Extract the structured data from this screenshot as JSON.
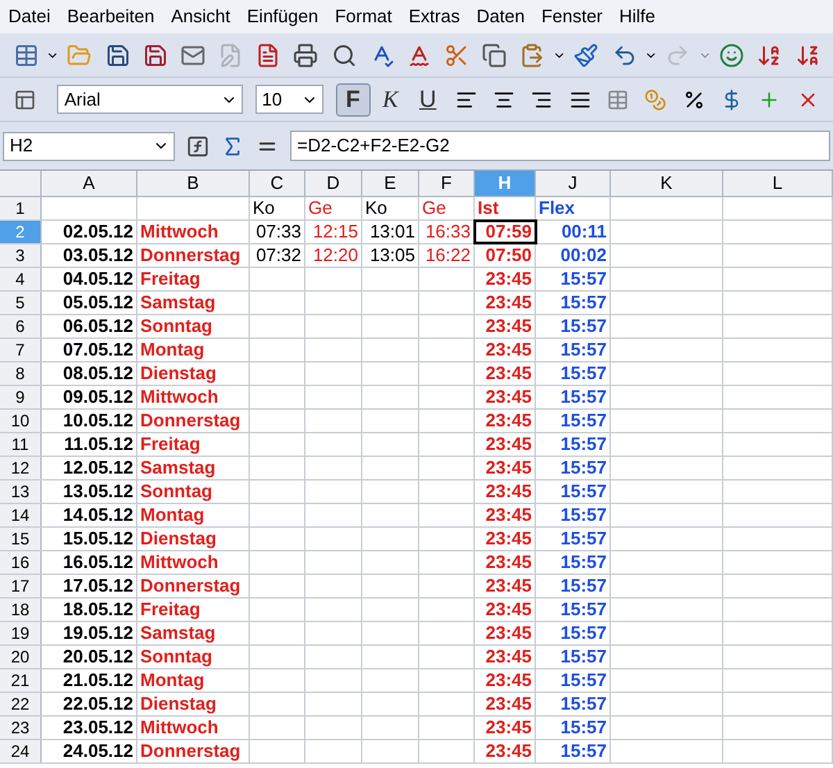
{
  "menu": [
    "Datei",
    "Bearbeiten",
    "Ansicht",
    "Einfügen",
    "Format",
    "Extras",
    "Daten",
    "Fenster",
    "Hilfe"
  ],
  "font_name": "Arial",
  "font_size": "10",
  "format_buttons": [
    {
      "label": "F",
      "selected": true
    },
    {
      "label": "K",
      "selected": false
    },
    {
      "label": "U",
      "selected": false
    }
  ],
  "name_box": "H2",
  "formula": "=D2-C2+F2-E2-G2",
  "columns": [
    {
      "label": "A",
      "selected": false
    },
    {
      "label": "B",
      "selected": false
    },
    {
      "label": "C",
      "selected": false
    },
    {
      "label": "D",
      "selected": false
    },
    {
      "label": "E",
      "selected": false
    },
    {
      "label": "F",
      "selected": false
    },
    {
      "label": "H",
      "selected": true
    },
    {
      "label": "J",
      "selected": false
    },
    {
      "label": "K",
      "selected": false
    },
    {
      "label": "L",
      "selected": false
    }
  ],
  "rows": [
    {
      "num": "1",
      "selected": false,
      "cells": {
        "C": "Ko",
        "D": "Ge",
        "E": "Ko",
        "F": "Ge",
        "H": "Ist",
        "J": "Flex"
      }
    },
    {
      "num": "2",
      "selected": true,
      "cells": {
        "A": "02.05.12",
        "B": "Mittwoch",
        "C": "07:33",
        "D": "12:15",
        "E": "13:01",
        "F": "16:33",
        "H": "07:59",
        "J": "00:11"
      }
    },
    {
      "num": "3",
      "selected": false,
      "cells": {
        "A": "03.05.12",
        "B": "Donnerstag",
        "C": "07:32",
        "D": "12:20",
        "E": "13:05",
        "F": "16:22",
        "H": "07:50",
        "J": "00:02"
      }
    },
    {
      "num": "4",
      "selected": false,
      "cells": {
        "A": "04.05.12",
        "B": "Freitag",
        "H": "23:45",
        "J": "15:57"
      }
    },
    {
      "num": "5",
      "selected": false,
      "cells": {
        "A": "05.05.12",
        "B": "Samstag",
        "H": "23:45",
        "J": "15:57"
      }
    },
    {
      "num": "6",
      "selected": false,
      "cells": {
        "A": "06.05.12",
        "B": "Sonntag",
        "H": "23:45",
        "J": "15:57"
      }
    },
    {
      "num": "7",
      "selected": false,
      "cells": {
        "A": "07.05.12",
        "B": "Montag",
        "H": "23:45",
        "J": "15:57"
      }
    },
    {
      "num": "8",
      "selected": false,
      "cells": {
        "A": "08.05.12",
        "B": "Dienstag",
        "H": "23:45",
        "J": "15:57"
      }
    },
    {
      "num": "9",
      "selected": false,
      "cells": {
        "A": "09.05.12",
        "B": "Mittwoch",
        "H": "23:45",
        "J": "15:57"
      }
    },
    {
      "num": "10",
      "selected": false,
      "cells": {
        "A": "10.05.12",
        "B": "Donnerstag",
        "H": "23:45",
        "J": "15:57"
      }
    },
    {
      "num": "11",
      "selected": false,
      "cells": {
        "A": "11.05.12",
        "B": "Freitag",
        "H": "23:45",
        "J": "15:57"
      }
    },
    {
      "num": "12",
      "selected": false,
      "cells": {
        "A": "12.05.12",
        "B": "Samstag",
        "H": "23:45",
        "J": "15:57"
      }
    },
    {
      "num": "13",
      "selected": false,
      "cells": {
        "A": "13.05.12",
        "B": "Sonntag",
        "H": "23:45",
        "J": "15:57"
      }
    },
    {
      "num": "14",
      "selected": false,
      "cells": {
        "A": "14.05.12",
        "B": "Montag",
        "H": "23:45",
        "J": "15:57"
      }
    },
    {
      "num": "15",
      "selected": false,
      "cells": {
        "A": "15.05.12",
        "B": "Dienstag",
        "H": "23:45",
        "J": "15:57"
      }
    },
    {
      "num": "16",
      "selected": false,
      "cells": {
        "A": "16.05.12",
        "B": "Mittwoch",
        "H": "23:45",
        "J": "15:57"
      }
    },
    {
      "num": "17",
      "selected": false,
      "cells": {
        "A": "17.05.12",
        "B": "Donnerstag",
        "H": "23:45",
        "J": "15:57"
      }
    },
    {
      "num": "18",
      "selected": false,
      "cells": {
        "A": "18.05.12",
        "B": "Freitag",
        "H": "23:45",
        "J": "15:57"
      }
    },
    {
      "num": "19",
      "selected": false,
      "cells": {
        "A": "19.05.12",
        "B": "Samstag",
        "H": "23:45",
        "J": "15:57"
      }
    },
    {
      "num": "20",
      "selected": false,
      "cells": {
        "A": "20.05.12",
        "B": "Sonntag",
        "H": "23:45",
        "J": "15:57"
      }
    },
    {
      "num": "21",
      "selected": false,
      "cells": {
        "A": "21.05.12",
        "B": "Montag",
        "H": "23:45",
        "J": "15:57"
      }
    },
    {
      "num": "22",
      "selected": false,
      "cells": {
        "A": "22.05.12",
        "B": "Dienstag",
        "H": "23:45",
        "J": "15:57"
      }
    },
    {
      "num": "23",
      "selected": false,
      "cells": {
        "A": "23.05.12",
        "B": "Mittwoch",
        "H": "23:45",
        "J": "15:57"
      }
    },
    {
      "num": "24",
      "selected": false,
      "cells": {
        "A": "24.05.12",
        "B": "Donnerstag",
        "H": "23:45",
        "J": "15:57"
      }
    }
  ]
}
